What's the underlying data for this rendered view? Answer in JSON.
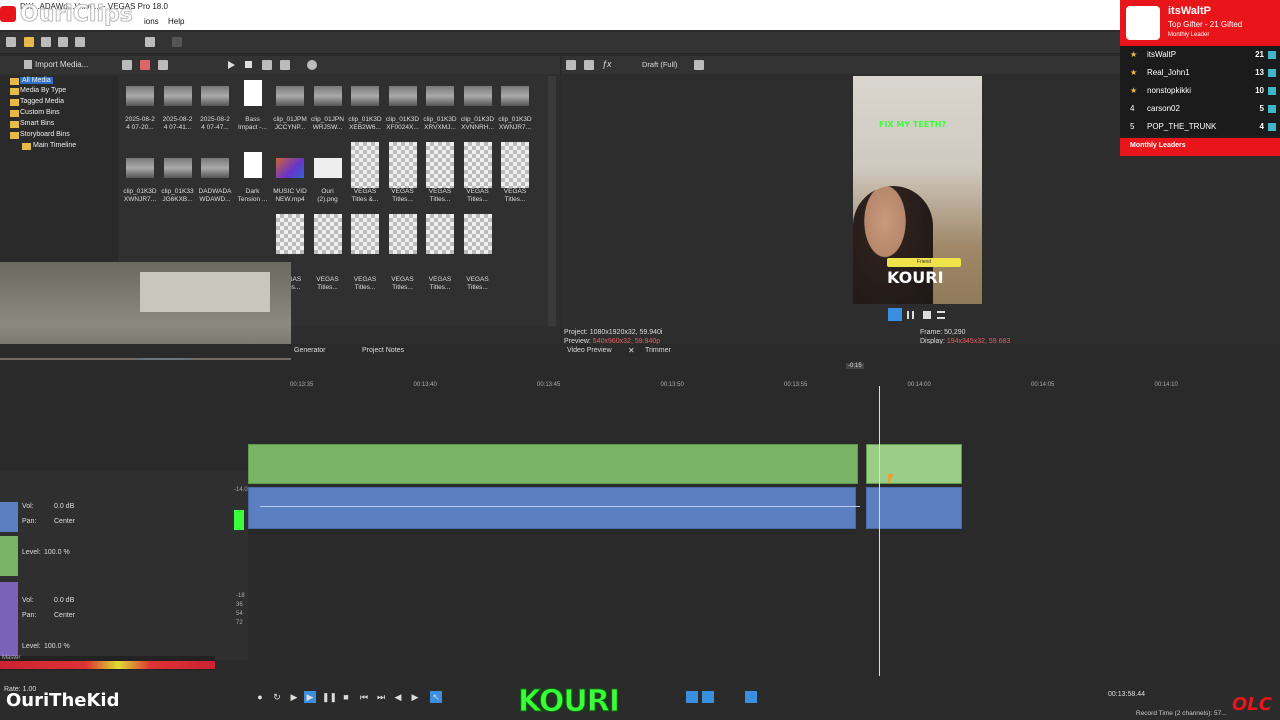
{
  "window": {
    "title": "VEGAS Pro 18.0",
    "title_partial": "DW...ADAWd...V...ve... - VEGAS Pro 18.0",
    "help_menu": "Help",
    "options_menu": "ions"
  },
  "stream_overlay": {
    "watermark": "OuriClips",
    "channel_name": "OuriTheKid",
    "kouri_logo": "KOURI",
    "olc_logo": "OLC",
    "top_gifter": {
      "name": "itsWaltP",
      "subtitle": "Top Gifter - 21 Gifted",
      "caption": "Monthly Leader"
    },
    "leaders": [
      {
        "rank": "★",
        "name": "itsWaltP",
        "count": "21"
      },
      {
        "rank": "★",
        "name": "Real_John1",
        "count": "13"
      },
      {
        "rank": "★",
        "name": "nonstopkikki",
        "count": "10"
      },
      {
        "rank": "4",
        "name": "carson02",
        "count": "5"
      },
      {
        "rank": "5",
        "name": "POP_THE_TRUNK",
        "count": "4"
      }
    ],
    "leaders_footer": "Monthly Leaders"
  },
  "explorer": {
    "import_label": "Import Media...",
    "tree": [
      "All Media",
      "Media By Type",
      "Tagged Media",
      "Custom Bins",
      "Smart Bins",
      "Storyboard Bins",
      "Main Timeline"
    ],
    "row1": [
      {
        "l1": "2025-08-2",
        "l2": "4 07-20..."
      },
      {
        "l1": "2025-08-2",
        "l2": "4 07-41..."
      },
      {
        "l1": "2025-08-2",
        "l2": "4 07-47..."
      },
      {
        "l1": "Bass",
        "l2": "Impact -..."
      },
      {
        "l1": "clip_01JPM",
        "l2": "JCCYNP..."
      },
      {
        "l1": "clip_01JPN",
        "l2": "WRJSW..."
      },
      {
        "l1": "clip_01K3D",
        "l2": "XEB2W6..."
      },
      {
        "l1": "clip_01K3D",
        "l2": "XF0024X..."
      },
      {
        "l1": "clip_01K3D",
        "l2": "XRVXMJ..."
      },
      {
        "l1": "clip_01K3D",
        "l2": "XVNNRH..."
      },
      {
        "l1": "clip_01K3D",
        "l2": "XWNJR7..."
      }
    ],
    "row2": [
      {
        "l1": "clip_01K3D",
        "l2": "XWNJR7..."
      },
      {
        "l1": "clip_01K33",
        "l2": "JG6KXB..."
      },
      {
        "l1": "DADWADA",
        "l2": "WDAWD..."
      },
      {
        "l1": "Dark",
        "l2": "Tension ..."
      },
      {
        "l1": "MUSIC VID",
        "l2": "NEW.mp4"
      },
      {
        "l1": "Ouri",
        "l2": "(2).png"
      },
      {
        "l1": "VEGAS",
        "l2": "Titles &..."
      },
      {
        "l1": "VEGAS",
        "l2": "Titles..."
      },
      {
        "l1": "VEGAS",
        "l2": "Titles..."
      },
      {
        "l1": "VEGAS",
        "l2": "Titles..."
      },
      {
        "l1": "VEGAS",
        "l2": "Titles..."
      }
    ],
    "row3": [
      {
        "l1": "VEGAS",
        "l2": "Titles..."
      },
      {
        "l1": "VEGAS",
        "l2": "Titles..."
      },
      {
        "l1": "VEGAS",
        "l2": "Titles..."
      },
      {
        "l1": "VEGAS",
        "l2": "Titles..."
      },
      {
        "l1": "VEGAS",
        "l2": "Titles..."
      },
      {
        "l1": "VEGAS",
        "l2": "Titles..."
      }
    ]
  },
  "tabs": {
    "generator": "Generator",
    "project_notes": "Project Notes",
    "video_preview": "Video Preview",
    "trimmer": "Trimmer"
  },
  "preview": {
    "quality": "Draft (Full)",
    "caption_top": "FIX MY TEETH?",
    "caption_tag": "Friend",
    "caption_bottom": "KOURI",
    "project_label": "Project:",
    "project_value": "1080x1920x32, 59.940i",
    "preview_label": "Preview:",
    "preview_value": "540x960x32, 59.940p",
    "frame_label": "Frame:",
    "frame_value": "50,290",
    "display_label": "Display:",
    "display_value": "194x345x32, 59.683"
  },
  "timeline": {
    "ruler_marker": "-0:15",
    "ticks": [
      "00:13:35",
      "00:13:40",
      "00:13:45",
      "00:13:50",
      "00:13:55",
      "00:14:00",
      "00:14:05",
      "00:14:10"
    ],
    "track3": {
      "vol_label": "Vol:",
      "vol_value": "0.0 dB",
      "pan_label": "Pan:",
      "pan_value": "Center"
    },
    "track4": {
      "level_label": "Level:",
      "level_value": "100.0 %"
    },
    "track5": {
      "vol_label": "Vol:",
      "vol_value": "0.0 dB",
      "pan_label": "Pan:",
      "pan_value": "Center",
      "level_label": "Level:",
      "level_value": "100.0 %"
    },
    "meter_labels": [
      "-14.0",
      "-18",
      "36",
      "54",
      "72"
    ],
    "master_label": "Master"
  },
  "transport": {
    "rate": "Rate: 1.00",
    "timecode": "00:13:58.44",
    "record_time": "Record Time (2 channels): 57..."
  },
  "colors": {
    "video_track": "#78b366",
    "audio_track": "#5b7fc1",
    "accent_red": "#e8161b",
    "kouri_green": "#3aff3a"
  }
}
